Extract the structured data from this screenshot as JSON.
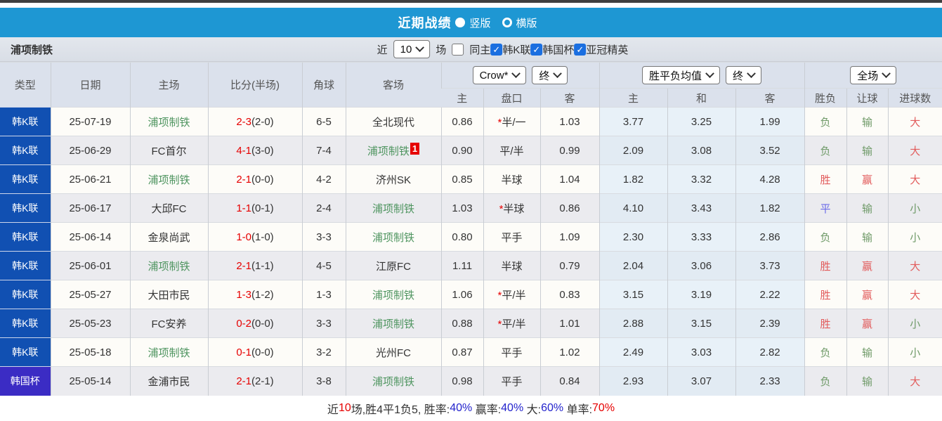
{
  "title_bar": {
    "title": "近期战绩",
    "radio_vertical": "竖版",
    "radio_horizontal": "横版",
    "bar_color": "#1e97d3"
  },
  "filter_bar": {
    "team": "浦项制铁",
    "near_label": "近",
    "matches_count": "10",
    "matches_label": "场",
    "same_home_label": "同主",
    "leagues": [
      {
        "label": "韩K联",
        "checked": true
      },
      {
        "label": "韩国杯",
        "checked": true
      },
      {
        "label": "亚冠精英",
        "checked": true
      }
    ]
  },
  "table": {
    "focus_team": "浦项制铁",
    "static_headers": {
      "type": "类型",
      "date": "日期",
      "home": "主场",
      "score": "比分(半场)",
      "corners": "角球",
      "away": "客场"
    },
    "selects": {
      "ah_source": "Crow*",
      "ah_time": "终",
      "avg_source": "胜平负均值",
      "avg_time": "终",
      "full_match": "全场"
    },
    "sub_headers": {
      "ah_home": "主",
      "handicap": "盘口",
      "ah_away": "客",
      "avg_home": "主",
      "avg_draw": "和",
      "avg_away": "客",
      "result": "胜负",
      "handicap_result": "让球",
      "goals_result": "进球数"
    },
    "rows": [
      {
        "type": "韩K联",
        "date": "25-07-19",
        "home": "浦项制铁",
        "score": "2-3",
        "half": "(2-0)",
        "corners": "6-5",
        "away": "全北现代",
        "ah_home": "0.86",
        "handicap_star": "*",
        "handicap": "半/一",
        "ah_away": "1.03",
        "avg_home": "3.77",
        "avg_draw": "3.25",
        "avg_away": "1.99",
        "result": "负",
        "handicap_result": "输",
        "goals_result": "大"
      },
      {
        "type": "韩K联",
        "date": "25-06-29",
        "home": "FC首尔",
        "score": "4-1",
        "half": "(3-0)",
        "corners": "7-4",
        "away": "浦项制铁",
        "away_badge": "1",
        "ah_home": "0.90",
        "handicap_star": "",
        "handicap": "平/半",
        "ah_away": "0.99",
        "avg_home": "2.09",
        "avg_draw": "3.08",
        "avg_away": "3.52",
        "result": "负",
        "handicap_result": "输",
        "goals_result": "大"
      },
      {
        "type": "韩K联",
        "date": "25-06-21",
        "home": "浦项制铁",
        "score": "2-1",
        "half": "(0-0)",
        "corners": "4-2",
        "away": "济州SK",
        "ah_home": "0.85",
        "handicap_star": "",
        "handicap": "半球",
        "ah_away": "1.04",
        "avg_home": "1.82",
        "avg_draw": "3.32",
        "avg_away": "4.28",
        "result": "胜",
        "handicap_result": "赢",
        "goals_result": "大"
      },
      {
        "type": "韩K联",
        "date": "25-06-17",
        "home": "大邱FC",
        "score": "1-1",
        "half": "(0-1)",
        "corners": "2-4",
        "away": "浦项制铁",
        "ah_home": "1.03",
        "handicap_star": "*",
        "handicap": "半球",
        "ah_away": "0.86",
        "avg_home": "4.10",
        "avg_draw": "3.43",
        "avg_away": "1.82",
        "result": "平",
        "handicap_result": "输",
        "goals_result": "小"
      },
      {
        "type": "韩K联",
        "date": "25-06-14",
        "home": "金泉尚武",
        "score": "1-0",
        "half": "(1-0)",
        "corners": "3-3",
        "away": "浦项制铁",
        "ah_home": "0.80",
        "handicap_star": "",
        "handicap": "平手",
        "ah_away": "1.09",
        "avg_home": "2.30",
        "avg_draw": "3.33",
        "avg_away": "2.86",
        "result": "负",
        "handicap_result": "输",
        "goals_result": "小"
      },
      {
        "type": "韩K联",
        "date": "25-06-01",
        "home": "浦项制铁",
        "score": "2-1",
        "half": "(1-1)",
        "corners": "4-5",
        "away": "江原FC",
        "ah_home": "1.11",
        "handicap_star": "",
        "handicap": "半球",
        "ah_away": "0.79",
        "avg_home": "2.04",
        "avg_draw": "3.06",
        "avg_away": "3.73",
        "result": "胜",
        "handicap_result": "赢",
        "goals_result": "大"
      },
      {
        "type": "韩K联",
        "date": "25-05-27",
        "home": "大田市民",
        "score": "1-3",
        "half": "(1-2)",
        "corners": "1-3",
        "away": "浦项制铁",
        "ah_home": "1.06",
        "handicap_star": "*",
        "handicap": "平/半",
        "ah_away": "0.83",
        "avg_home": "3.15",
        "avg_draw": "3.19",
        "avg_away": "2.22",
        "result": "胜",
        "handicap_result": "赢",
        "goals_result": "大"
      },
      {
        "type": "韩K联",
        "date": "25-05-23",
        "home": "FC安养",
        "score": "0-2",
        "half": "(0-0)",
        "corners": "3-3",
        "away": "浦项制铁",
        "ah_home": "0.88",
        "handicap_star": "*",
        "handicap": "平/半",
        "ah_away": "1.01",
        "avg_home": "2.88",
        "avg_draw": "3.15",
        "avg_away": "2.39",
        "result": "胜",
        "handicap_result": "赢",
        "goals_result": "小"
      },
      {
        "type": "韩K联",
        "date": "25-05-18",
        "home": "浦项制铁",
        "score": "0-1",
        "half": "(0-0)",
        "corners": "3-2",
        "away": "光州FC",
        "ah_home": "0.87",
        "handicap_star": "",
        "handicap": "平手",
        "ah_away": "1.02",
        "avg_home": "2.49",
        "avg_draw": "3.03",
        "avg_away": "2.82",
        "result": "负",
        "handicap_result": "输",
        "goals_result": "小"
      },
      {
        "type": "韩国杯",
        "date": "25-05-14",
        "home": "金浦市民",
        "score": "2-1",
        "half": "(2-1)",
        "corners": "3-8",
        "away": "浦项制铁",
        "ah_home": "0.98",
        "handicap_star": "",
        "handicap": "平手",
        "ah_away": "0.84",
        "avg_home": "2.93",
        "avg_draw": "3.07",
        "avg_away": "2.33",
        "result": "负",
        "handicap_result": "输",
        "goals_result": "大"
      }
    ]
  },
  "summary": {
    "segments": [
      {
        "text": "近",
        "color": "#333333"
      },
      {
        "text": "10",
        "color": "#e60000"
      },
      {
        "text": "场,胜4平1负5, 胜率:",
        "color": "#333333"
      },
      {
        "text": "40%",
        "color": "#2323cc"
      },
      {
        "text": " 赢率:",
        "color": "#333333"
      },
      {
        "text": "40%",
        "color": "#2323cc"
      },
      {
        "text": " 大:",
        "color": "#333333"
      },
      {
        "text": "60%",
        "color": "#2323cc"
      },
      {
        "text": " 单率:",
        "color": "#333333"
      },
      {
        "text": "70%",
        "color": "#e60000"
      }
    ]
  },
  "colors": {
    "league_type_bg": "#1150b2",
    "cup_type_bg": "#3b2cc4",
    "focus_team_green": "#4f9560",
    "win_red": "#e25c5c",
    "lose_green": "#6f9a68",
    "draw_blue": "#6b6be8",
    "score_red": "#e60000",
    "title_bar_blue": "#1e97d3"
  }
}
